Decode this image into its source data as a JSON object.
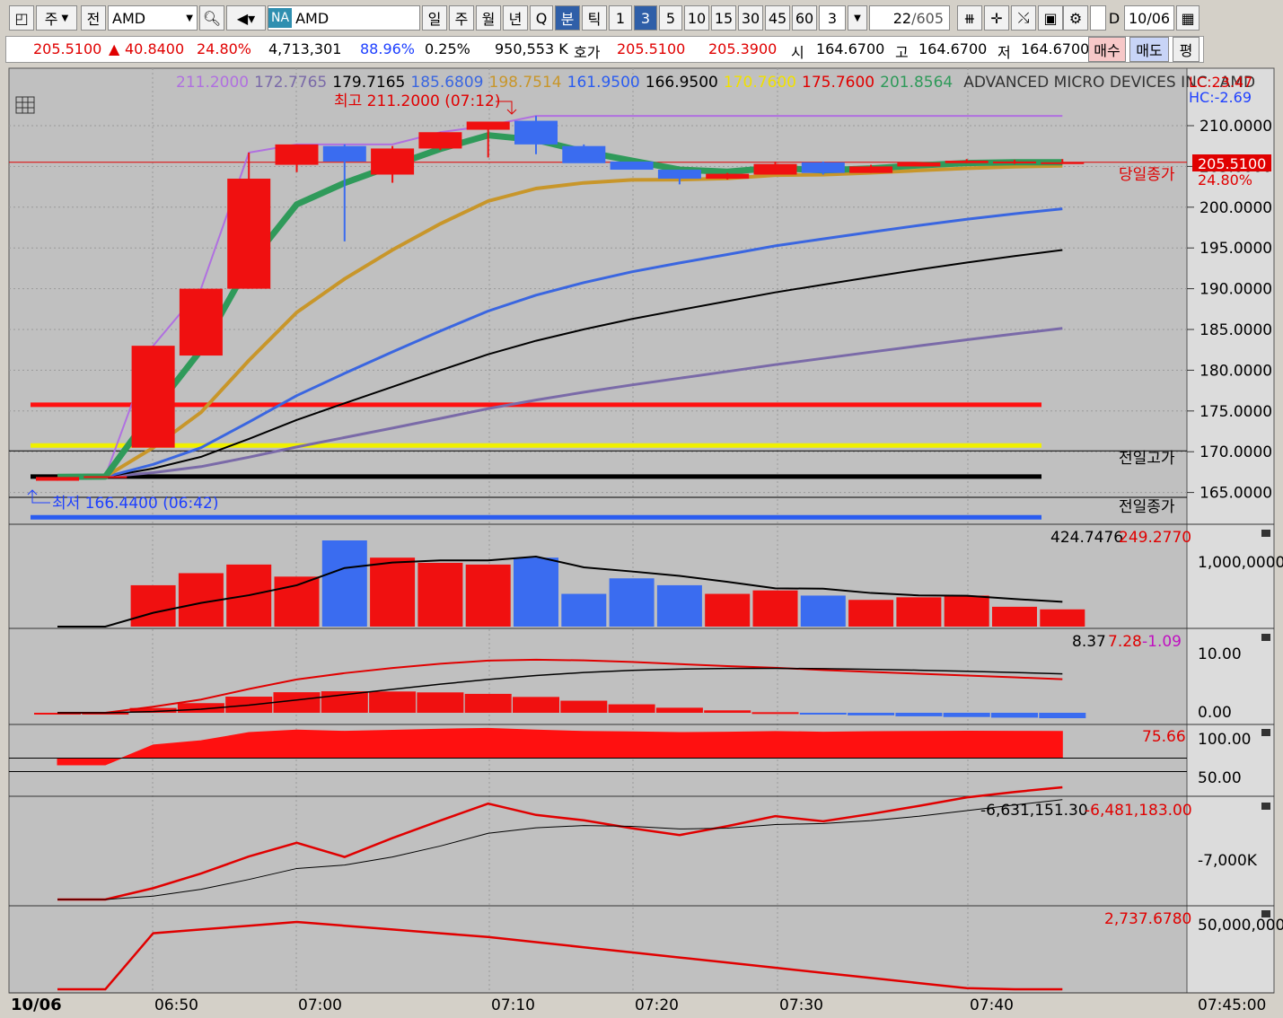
{
  "toolbar": {
    "market": "주",
    "pre": "전",
    "symbol": "AMD",
    "exchange_badge": "NA",
    "name_field": "AMD",
    "periods": [
      "일",
      "주",
      "월",
      "년",
      "Q",
      "분",
      "틱"
    ],
    "selected_period": "분",
    "intervals": [
      "1",
      "3",
      "5",
      "10",
      "15",
      "30",
      "45",
      "60"
    ],
    "selected_interval": "3",
    "interval_value": "3",
    "count": "22",
    "total": "/605",
    "d_label": "D",
    "date": "10/06"
  },
  "quote": {
    "price": "205.5100",
    "arrow": "▲",
    "change": "40.8400",
    "change_pct": "24.80%",
    "volume": "4,713,301",
    "vol_ratio": "88.96%",
    "turnover": "0.25%",
    "amount": "950,553 K",
    "bid_label": "호가",
    "bid1": "205.5100",
    "bid2": "205.3900",
    "open_label": "시",
    "open": "164.6700",
    "high_label": "고",
    "high": "164.6700",
    "low_label": "저",
    "low": "164.6700",
    "buy_label": "매수",
    "sell_label": "매도",
    "eval_label": "평"
  },
  "legend": {
    "values": [
      {
        "text": "211.2000",
        "color": "#b070e0"
      },
      {
        "text": "172.7765",
        "color": "#7a6aa8"
      },
      {
        "text": "179.7165",
        "color": "#000000"
      },
      {
        "text": "185.6809",
        "color": "#3a66e0"
      },
      {
        "text": "198.7514",
        "color": "#c8962a"
      },
      {
        "text": "161.9500",
        "color": "#2a5cf0"
      },
      {
        "text": "166.9500",
        "color": "#000000"
      },
      {
        "text": "170.7600",
        "color": "#f0e000"
      },
      {
        "text": "175.7600",
        "color": "#e00000"
      },
      {
        "text": "201.8564",
        "color": "#2f9a5a"
      }
    ],
    "name": "ADVANCED MICRO DEVICES INC",
    "ticker": "AMD",
    "lc": "LC:23.47",
    "hc": "HC:-2.69"
  },
  "annotations": {
    "high": "최고 211.2000 (07:12)",
    "low": "최저 166.4400 (06:42)",
    "today_close": "당일종가",
    "prev_high": "전일고가",
    "prev_close": "전일종가",
    "price_tag": "205.5100",
    "price_tag_pct": "24.80%"
  },
  "colors": {
    "up": "#f01010",
    "down": "#3a6cf0",
    "panel_bg": "#c0c0c0"
  },
  "price_axis": [
    "210.0000",
    "205.0000",
    "200.0000",
    "195.0000",
    "190.0000",
    "185.0000",
    "180.0000",
    "175.0000",
    "170.0000",
    "165.0000"
  ],
  "time_axis": {
    "date": "10/06",
    "labels": [
      "06:50",
      "07:00",
      "07:10",
      "07:20",
      "07:30",
      "07:40"
    ],
    "end": "07:45:00"
  },
  "volume_panel": {
    "v1": "424.7476",
    "v2": "249.2770",
    "axis": "1,000,0000"
  },
  "macd_panel": {
    "v1": "8.37",
    "v2": "7.28",
    "v3": "-1.09",
    "axis": [
      "10.00",
      "0.00"
    ]
  },
  "rsi_panel": {
    "v1": "75.66",
    "axis": [
      "100.00",
      "50.00"
    ]
  },
  "obv_panel": {
    "v1": "-6,631,151.30",
    "v2": "-6,481,183.00",
    "axis": "-7,000K"
  },
  "panel6": {
    "v1": "2,737.6780",
    "axis": "50,000,000"
  },
  "chart_data": {
    "type": "candlestick",
    "interval": "3분",
    "times": [
      "06:42",
      "06:45",
      "06:48",
      "06:51",
      "06:54",
      "06:57",
      "07:00",
      "07:03",
      "07:06",
      "07:09",
      "07:12",
      "07:15",
      "07:18",
      "07:21",
      "07:24",
      "07:27",
      "07:30",
      "07:33",
      "07:36",
      "07:39",
      "07:42",
      "07:45"
    ],
    "ohlc": [
      [
        166.44,
        166.9,
        166.44,
        166.9
      ],
      [
        166.9,
        167.0,
        166.9,
        167.0
      ],
      [
        170.5,
        183.0,
        170.5,
        183.0
      ],
      [
        181.8,
        190.0,
        181.8,
        190.0
      ],
      [
        190.0,
        206.7,
        190.0,
        203.5
      ],
      [
        205.2,
        207.7,
        204.3,
        207.7
      ],
      [
        207.5,
        207.7,
        195.8,
        205.6
      ],
      [
        204.0,
        207.5,
        203.0,
        207.2
      ],
      [
        207.2,
        209.2,
        207.0,
        209.2
      ],
      [
        209.5,
        210.0,
        206.1,
        210.5
      ],
      [
        210.6,
        211.2,
        206.5,
        207.7
      ],
      [
        207.5,
        207.7,
        205.6,
        205.4
      ],
      [
        205.6,
        205.6,
        204.8,
        204.6
      ],
      [
        204.6,
        204.6,
        202.8,
        203.5
      ],
      [
        203.5,
        204.2,
        203.4,
        204.1
      ],
      [
        204.0,
        205.6,
        204.0,
        205.3
      ],
      [
        205.5,
        205.6,
        204.0,
        204.2
      ],
      [
        204.2,
        205.2,
        204.2,
        205.0
      ],
      [
        205.0,
        205.5,
        205.0,
        205.5
      ],
      [
        205.4,
        205.9,
        205.4,
        205.7
      ],
      [
        205.4,
        205.8,
        205.3,
        205.6
      ],
      [
        205.51,
        205.9,
        205.3,
        205.51
      ]
    ],
    "volume": [
      0,
      0,
      480000,
      620000,
      720000,
      580000,
      1000000,
      800000,
      740000,
      720000,
      800000,
      380000,
      560000,
      480000,
      380000,
      420000,
      360000,
      310000,
      340000,
      360000,
      230000,
      200000
    ]
  }
}
